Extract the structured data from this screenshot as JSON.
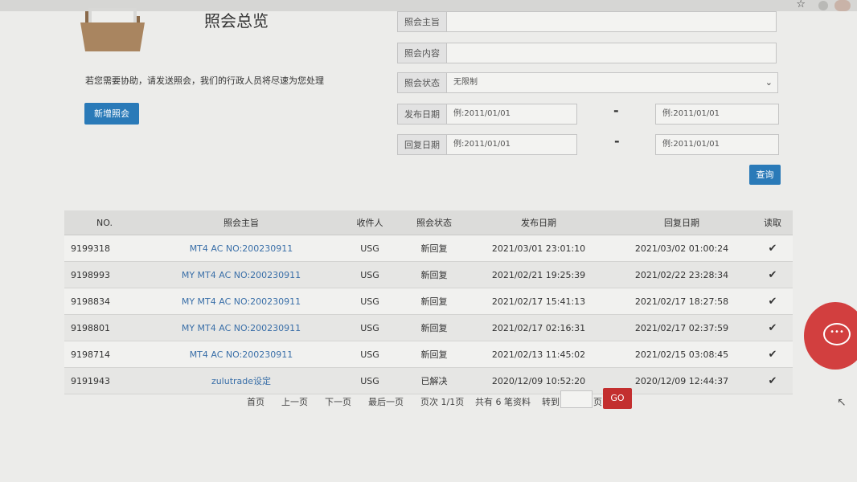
{
  "page": {
    "title": "照会总览",
    "help_text": "若您需要协助，请发送照会，我们的行政人员将尽速为您处理",
    "new_button": "新增照会"
  },
  "form": {
    "subject_label": "照会主旨",
    "content_label": "照会内容",
    "status_label": "照会状态",
    "status_value": "无限制",
    "publish_label": "发布日期",
    "reply_label": "回复日期",
    "date_placeholder": "例:2011/01/01",
    "dash": "-",
    "query_button": "查询"
  },
  "table": {
    "headers": [
      "NO.",
      "照会主旨",
      "收件人",
      "照会状态",
      "发布日期",
      "回复日期",
      "读取"
    ],
    "rows": [
      {
        "no": "9199318",
        "subject": "MT4 AC NO:200230911",
        "recipient": "USG",
        "status": "新回复",
        "published": "2021/03/01 23:01:10",
        "replied": "2021/03/02 01:00:24",
        "read": "✔"
      },
      {
        "no": "9198993",
        "subject": "MY MT4 AC NO:200230911",
        "recipient": "USG",
        "status": "新回复",
        "published": "2021/02/21 19:25:39",
        "replied": "2021/02/22 23:28:34",
        "read": "✔"
      },
      {
        "no": "9198834",
        "subject": "MY MT4 AC NO:200230911",
        "recipient": "USG",
        "status": "新回复",
        "published": "2021/02/17 15:41:13",
        "replied": "2021/02/17 18:27:58",
        "read": "✔"
      },
      {
        "no": "9198801",
        "subject": "MY MT4 AC NO:200230911",
        "recipient": "USG",
        "status": "新回复",
        "published": "2021/02/17 02:16:31",
        "replied": "2021/02/17 02:37:59",
        "read": "✔"
      },
      {
        "no": "9198714",
        "subject": "MT4 AC NO:200230911",
        "recipient": "USG",
        "status": "新回复",
        "published": "2021/02/13 11:45:02",
        "replied": "2021/02/15 03:08:45",
        "read": "✔"
      },
      {
        "no": "9191943",
        "subject": "zulutrade设定",
        "recipient": "USG",
        "status": "已解决",
        "published": "2020/12/09 10:52:20",
        "replied": "2020/12/09 12:44:37",
        "read": "✔"
      }
    ]
  },
  "pager": {
    "first": "首页",
    "prev": "上一页",
    "next": "下一页",
    "last": "最后一页",
    "page_info": "页次 1/1页",
    "total": "共有 6 笔资料",
    "goto": "转到",
    "page_suffix": "页",
    "go_button": "GO"
  },
  "chat": {
    "icon_text": "•••"
  },
  "colors": {
    "primary": "#2a7ab8",
    "danger": "#c32f2f",
    "link": "#3a6fa8",
    "chat": "#d23f3f"
  }
}
